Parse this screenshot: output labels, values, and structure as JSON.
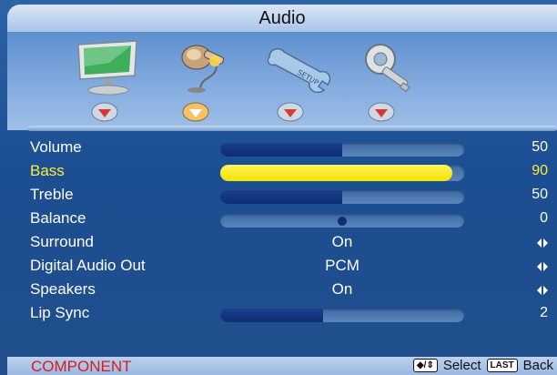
{
  "header": {
    "title": "Audio"
  },
  "menu_icons": [
    {
      "name": "picture-icon"
    },
    {
      "name": "audio-icon"
    },
    {
      "name": "setup-icon"
    },
    {
      "name": "lock-icon"
    }
  ],
  "items": [
    {
      "label": "Volume",
      "value": "50",
      "level": 0.5,
      "kind": "slider"
    },
    {
      "label": "Bass",
      "value": "90",
      "level": 0.95,
      "kind": "slider",
      "selected": true
    },
    {
      "label": "Treble",
      "value": "50",
      "level": 0.5,
      "kind": "slider"
    },
    {
      "label": "Balance",
      "value": "0",
      "level": 0.5,
      "kind": "balance"
    },
    {
      "label": "Surround",
      "option": "On",
      "kind": "option"
    },
    {
      "label": "Digital Audio Out",
      "option": "PCM",
      "kind": "option"
    },
    {
      "label": "Speakers",
      "option": "On",
      "kind": "option"
    },
    {
      "label": "Lip Sync",
      "value": "2",
      "level": 0.42,
      "kind": "slider"
    }
  ],
  "footer": {
    "source": "COMPONENT",
    "nav_key": "◆/⇕",
    "select_label": "Select",
    "last_key": "LAST",
    "back_label": "Back"
  },
  "colors": {
    "selected_text": "#ffeb3b",
    "source_text": "#d81b1b",
    "background": "#1b4e92"
  }
}
